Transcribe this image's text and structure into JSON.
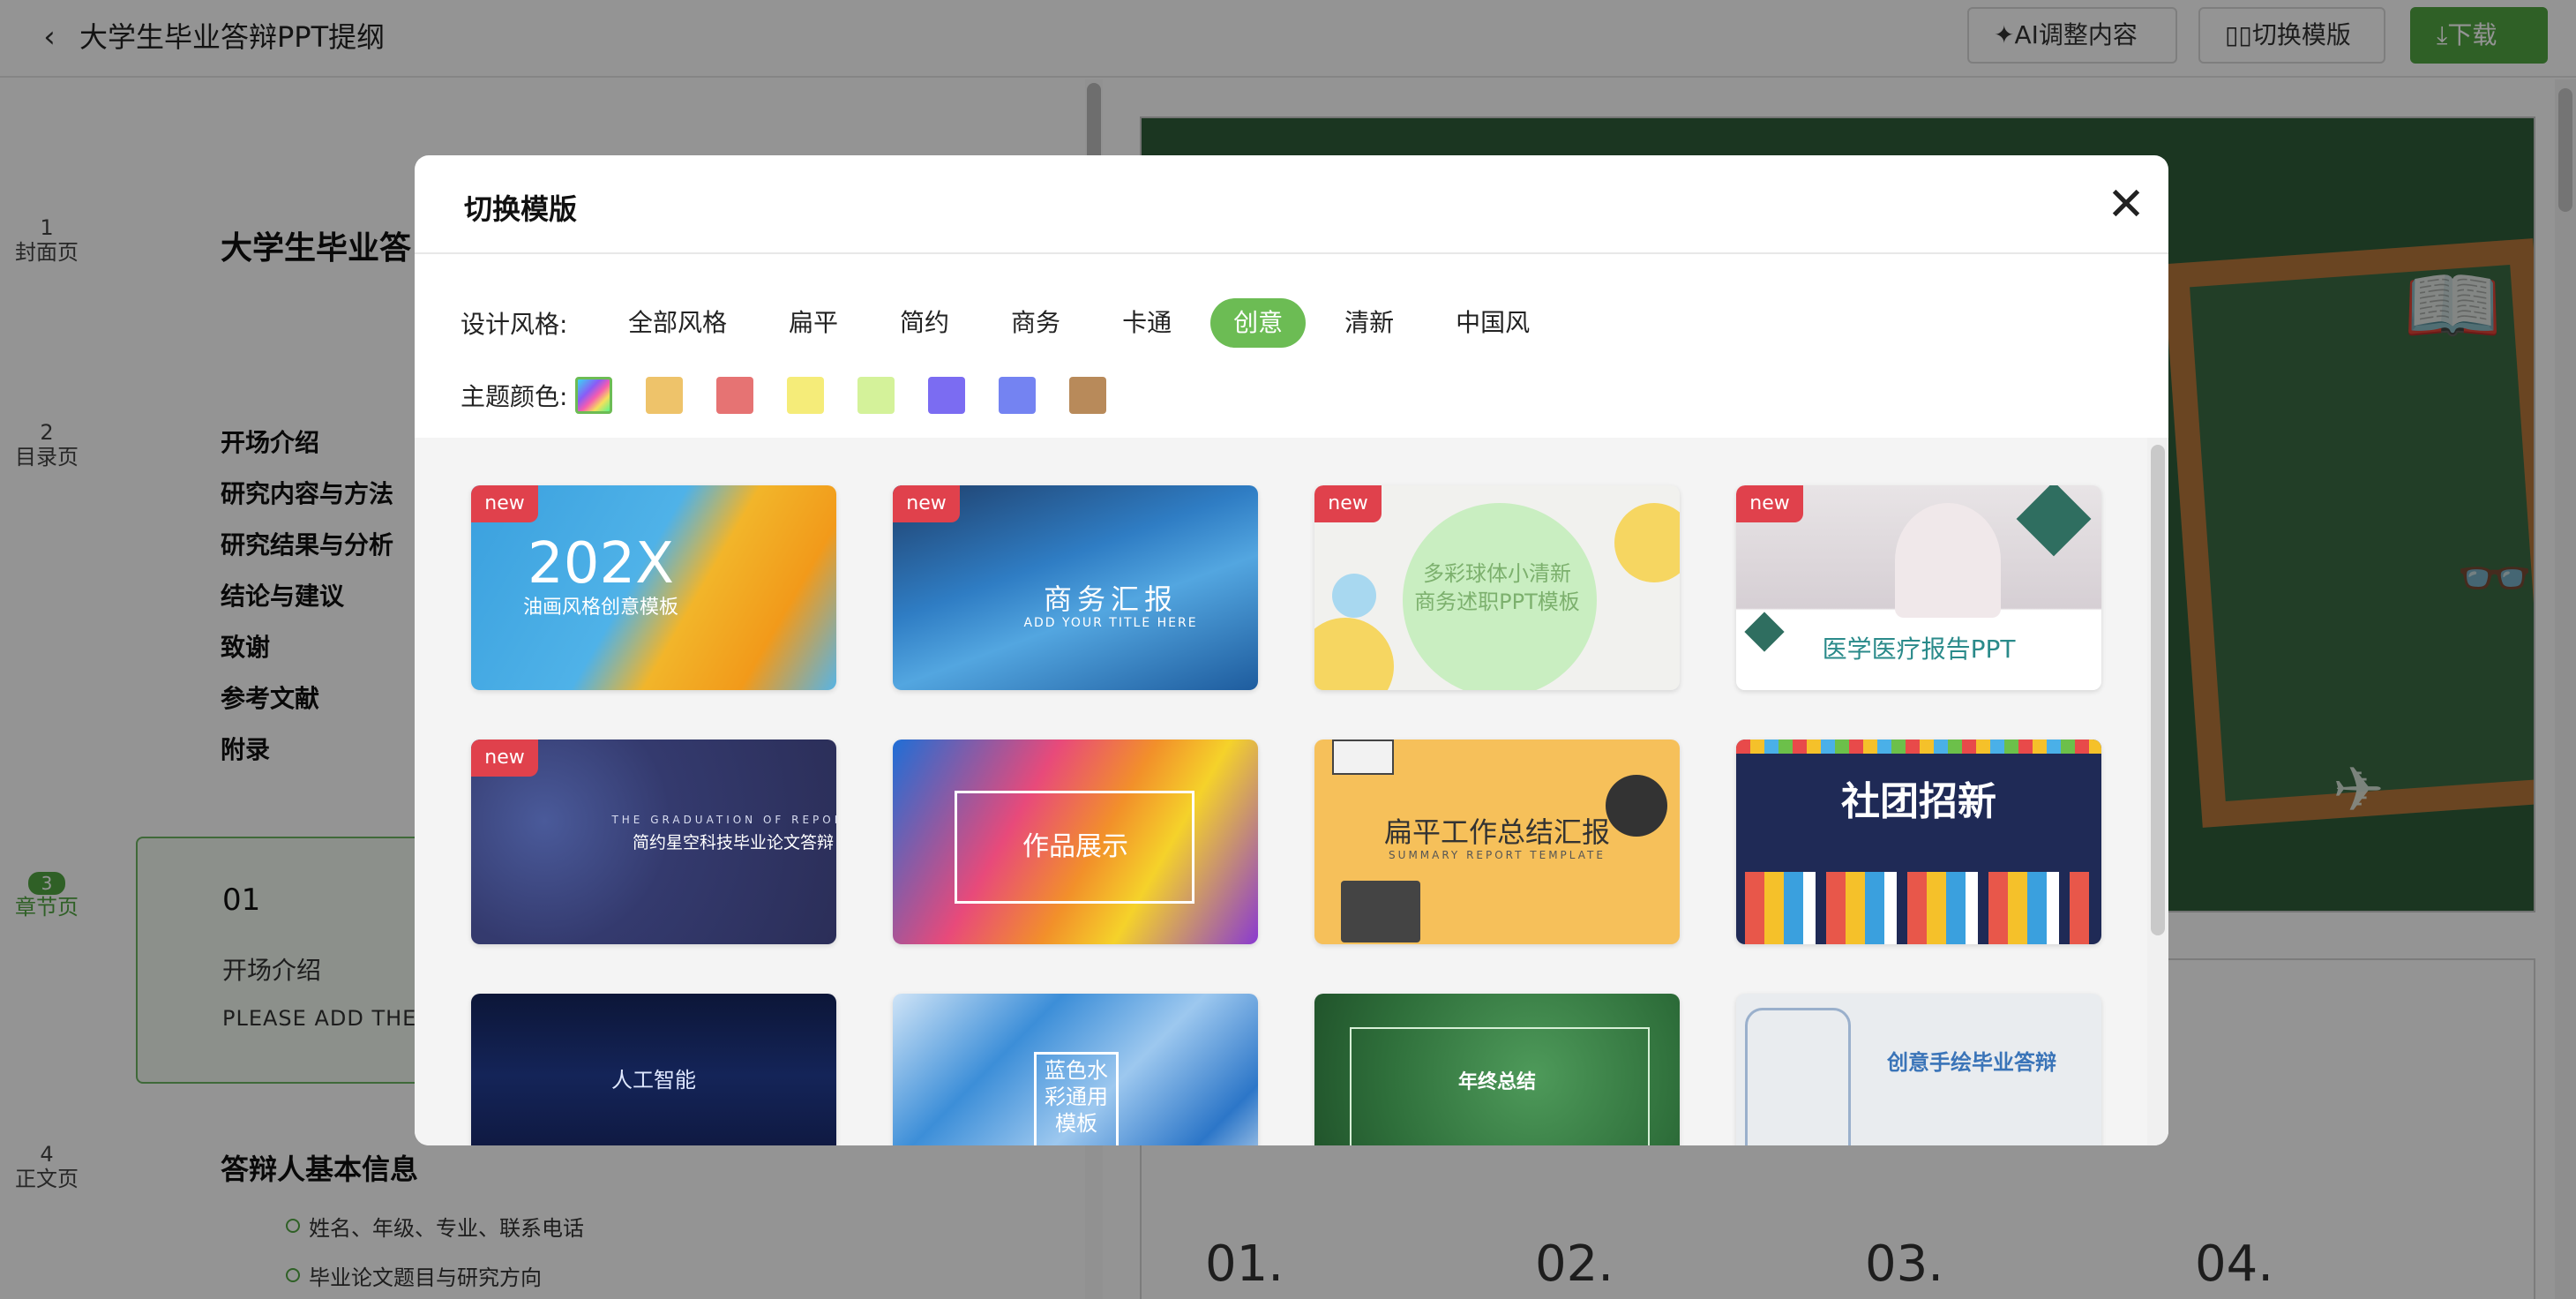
{
  "topbar": {
    "back_glyph": "‹",
    "title": "大学生毕业答辩PPT提纲",
    "ai_button": "✦AI调整内容",
    "switch_button": "▯▯切换模版",
    "download_button": "⤓下载"
  },
  "outline": {
    "pages": [
      {
        "num": "1",
        "label": "封面页"
      },
      {
        "num": "2",
        "label": "目录页"
      },
      {
        "num": "3",
        "label": "章节页"
      },
      {
        "num": "4",
        "label": "正文页"
      }
    ],
    "cover_title": "大学生毕业答",
    "toc_items": [
      "开场介绍",
      "研究内容与方法",
      "研究结果与分析",
      "结论与建议",
      "致谢",
      "参考文献",
      "附录"
    ],
    "chapter": {
      "num": "01",
      "title": "开场介绍",
      "subtitle": "PLEASE  ADD THE T"
    },
    "body_title": "答辩人基本信息",
    "body_bullets": [
      "姓名、年级、专业、联系电话",
      "毕业论文题目与研究方向"
    ]
  },
  "preview": {
    "numbers": [
      "01.",
      "02.",
      "03.",
      "04."
    ]
  },
  "modal": {
    "title": "切换模版",
    "close_glyph": "✕",
    "style_label": "设计风格:",
    "styles": [
      "全部风格",
      "扁平",
      "简约",
      "商务",
      "卡通",
      "创意",
      "清新",
      "中国风"
    ],
    "active_style": "创意",
    "color_label": "主题颜色:",
    "colors": [
      "rainbow",
      "#eec36a",
      "#e67373",
      "#f5ec79",
      "#d4f29a",
      "#7b6cf2",
      "#7483f2",
      "#b88a5a"
    ],
    "new_badge": "new",
    "templates": [
      {
        "title": "202X",
        "sub": "油画风格创意模板",
        "new": true
      },
      {
        "title": "商务汇报",
        "sub": "ADD YOUR TITLE HERE",
        "new": true
      },
      {
        "title": "多彩球体小清新",
        "sub": "商务述职PPT模板",
        "new": true
      },
      {
        "title": "医学医疗报告PPT",
        "sub": "",
        "new": true
      },
      {
        "title": "简约星空科技毕业论文答辩",
        "sub": "THE GRADUATION OF REPORT",
        "new": true
      },
      {
        "title": "作品展示",
        "sub": "",
        "new": false
      },
      {
        "title": "扁平工作总结汇报",
        "sub": "SUMMARY REPORT TEMPLATE",
        "new": false
      },
      {
        "title": "社团招新",
        "sub": "",
        "new": false
      },
      {
        "title": "人工智能",
        "sub": "",
        "new": false
      },
      {
        "title": "蓝色水彩通用模板",
        "sub": "",
        "new": false
      },
      {
        "title": "年终总结",
        "sub": "",
        "new": false
      },
      {
        "title": "创意手绘毕业答辩",
        "sub": "",
        "new": false
      }
    ]
  }
}
